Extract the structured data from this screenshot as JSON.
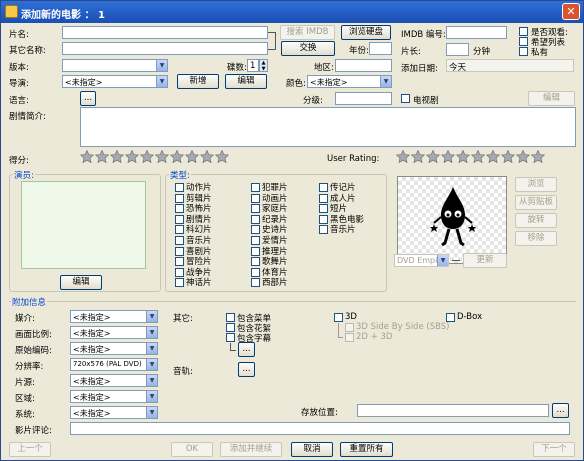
{
  "window": {
    "title": "添加新的电影 ： 1"
  },
  "labels": {
    "title": "片名:",
    "other_titles": "其它名称:",
    "edition": "版本:",
    "director": "导演:",
    "language": "语言:",
    "plot": "剧情简介:",
    "rating": "得分:",
    "user_rating": "User Rating:",
    "discs": "碟数:",
    "region": "地区:",
    "year": "年份:",
    "color": "颜色:",
    "certification": "分级:",
    "imdb_id": "IMDB 编号:",
    "runtime": "片长:",
    "minutes": "分钟",
    "date_added": "添加日期:",
    "tv_series": "电视剧",
    "cast": "演员:",
    "genres": "类型:"
  },
  "fields": {
    "director_value": "<未指定>",
    "color_value": "<未指定>",
    "discs_value": "1",
    "date_added_value": "今天"
  },
  "buttons": {
    "search_imdb": "搜索 IMDB",
    "browse_disc": "浏览硬盘",
    "swap": "交换",
    "new": "新增",
    "edit": "编辑",
    "language_more": "...",
    "certification_edit": "编辑",
    "cast_edit": "编辑",
    "browse_cover": "浏览",
    "from_clipboard": "从剪贴板",
    "rotate": "旋转",
    "remove": "移除",
    "update": "更新",
    "prev": "上一个",
    "ok": "OK",
    "add_continue": "添加并继续",
    "cancel": "取消",
    "reset_all": "重置所有",
    "next": "下一个",
    "extras_more": "...",
    "audio_more": "...",
    "location_more": "..."
  },
  "flags": {
    "seen": "是否观看:",
    "wishlist": "希望列表",
    "private": "私有"
  },
  "genres": [
    "动作片",
    "剪辑片",
    "恐怖片",
    "剧情片",
    "科幻片",
    "音乐片",
    "喜剧片",
    "冒险片",
    "战争片",
    "神话片",
    "犯罪片",
    "动画片",
    "家庭片",
    "纪录片",
    "史诗片",
    "爱情片",
    "推理片",
    "歌舞片",
    "体育片",
    "西部片",
    "传记片",
    "成人片",
    "短片",
    "黑色电影",
    "音乐片"
  ],
  "cover": {
    "size_value": "DVD Empire"
  },
  "extra": {
    "section_title": "附加信息",
    "media_label": "媒介:",
    "aspect_label": "画面比例:",
    "encoding_label": "原始编码:",
    "resolution_label": "分辨率:",
    "frames_label": "片源:",
    "region_label": "区域:",
    "system_label": "系统:",
    "review_label": "影片评论:",
    "other_label": "其它:",
    "audio_label": "音轨:",
    "location_label": "存放位置:",
    "media_value": "<未指定>",
    "aspect_value": "<未指定>",
    "encoding_value": "<未指定>",
    "resolution_value": "720x576 (PAL DVD)",
    "frames_value": "<未指定>",
    "region_value": "<未指定>",
    "system_value": "<未指定>",
    "extras": [
      "包含菜单",
      "包含花絮",
      "包含字幕"
    ],
    "formats": [
      "3D",
      "3D Side By Side (SBS)",
      "2D + 3D"
    ],
    "dbox": "D-Box"
  },
  "ratings": {
    "score": 0,
    "max": 10,
    "user_score": 0
  },
  "colors": {
    "titlebar": "#1b4fb4",
    "accent_blue": "#0046d5",
    "cast_list_bg": "#edf8e8",
    "star_fill": "#9aa0a6"
  }
}
